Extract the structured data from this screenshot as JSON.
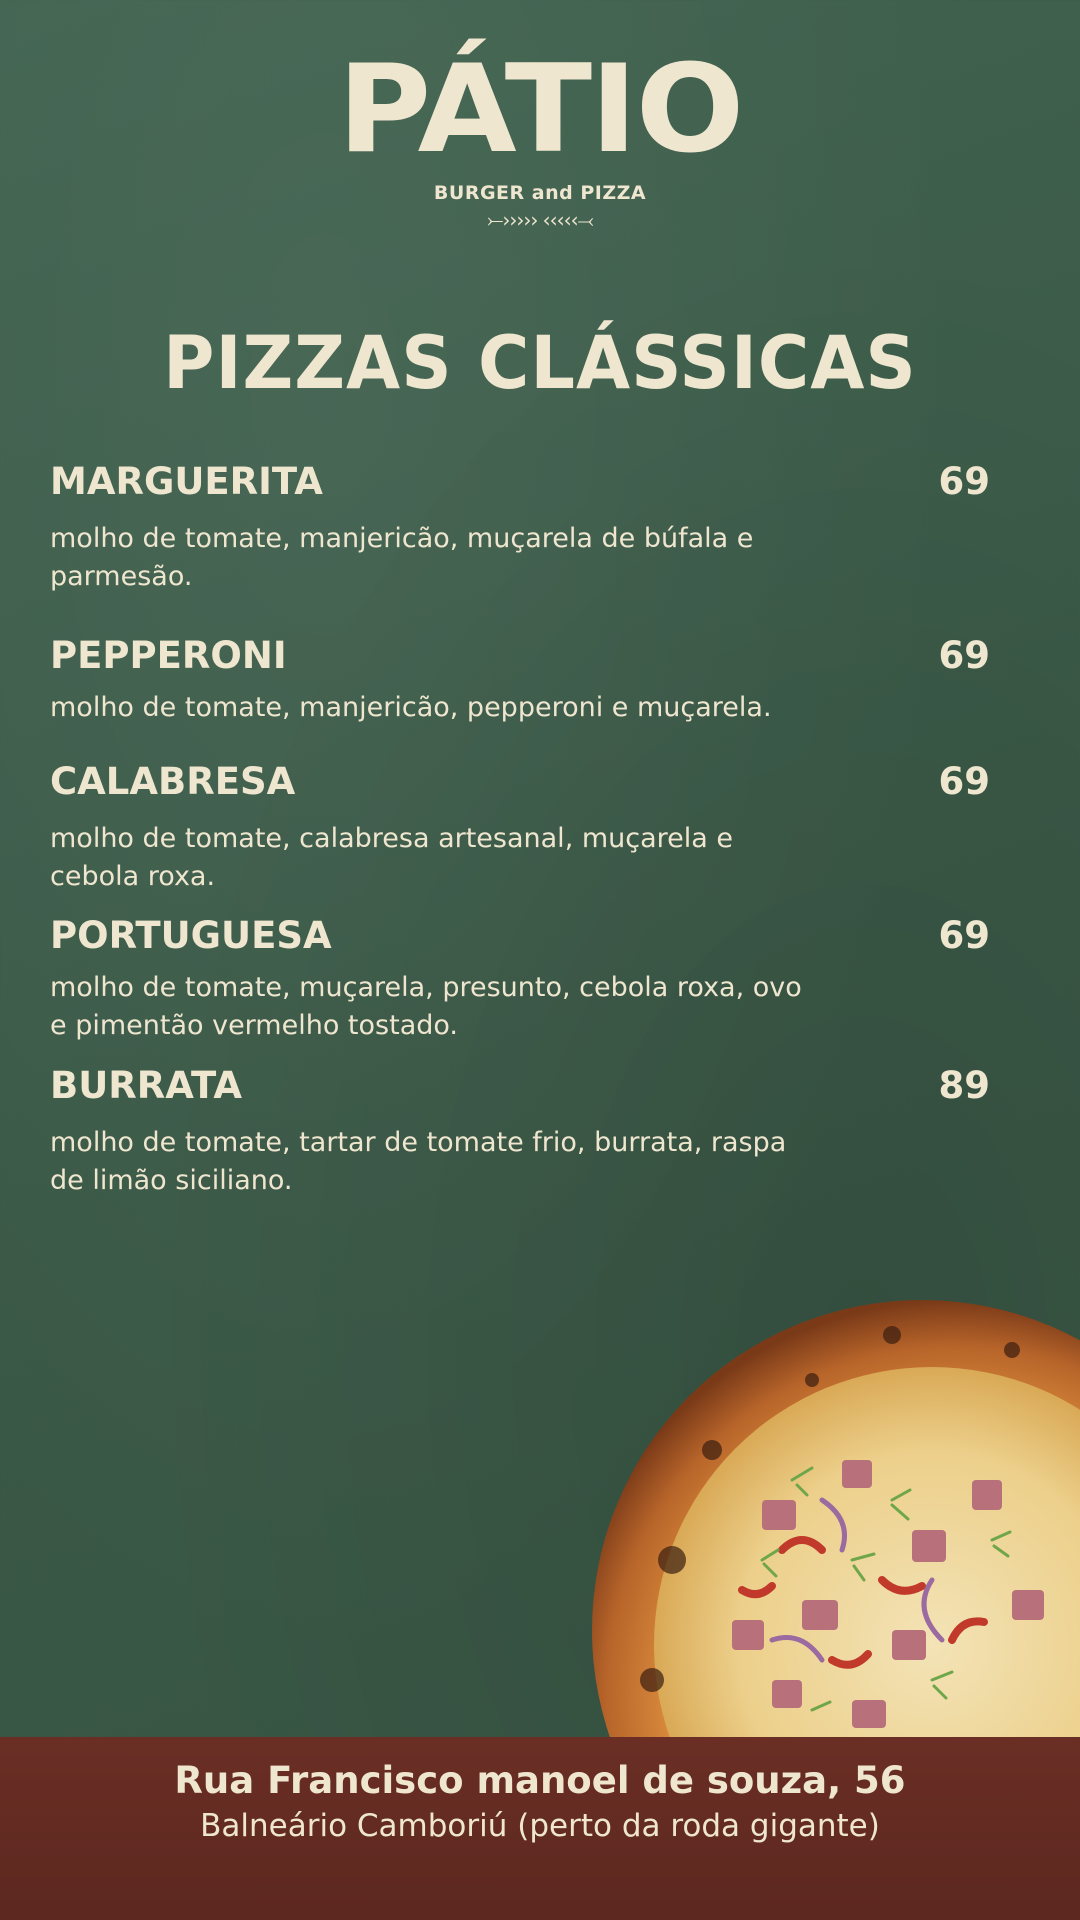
{
  "brand": {
    "name": "PÁTIO",
    "tagline": "BURGER and PIZZA",
    "ornament": "⤚››››› ‹‹‹‹‹⤙"
  },
  "section_title": "PIZZAS CLÁSSICAS",
  "menu": [
    {
      "name": "MARGUERITA",
      "price": "69",
      "description": "molho de tomate, manjericão, muçarela de búfala e parmesão."
    },
    {
      "name": "PEPPERONI",
      "price": "69",
      "description": "molho de tomate, manjericão, pepperoni e muçarela."
    },
    {
      "name": "CALABRESA",
      "price": "69",
      "description": "molho de tomate, calabresa artesanal, muçarela e cebola roxa."
    },
    {
      "name": "PORTUGUESA",
      "price": "69",
      "description": "molho de tomate, muçarela, presunto, cebola roxa, ovo e pimentão vermelho tostado."
    },
    {
      "name": "BURRATA",
      "price": "89",
      "description": "molho de tomate, tartar de tomate frio, burrata, raspa de limão siciliano."
    }
  ],
  "footer": {
    "address": "Rua Francisco manoel de souza, 56",
    "city": "Balneário Camboriú (perto da roda gigante)"
  },
  "colors": {
    "background": "#3c5b49",
    "text": "#efe6cf",
    "footer": "#5c2820"
  }
}
